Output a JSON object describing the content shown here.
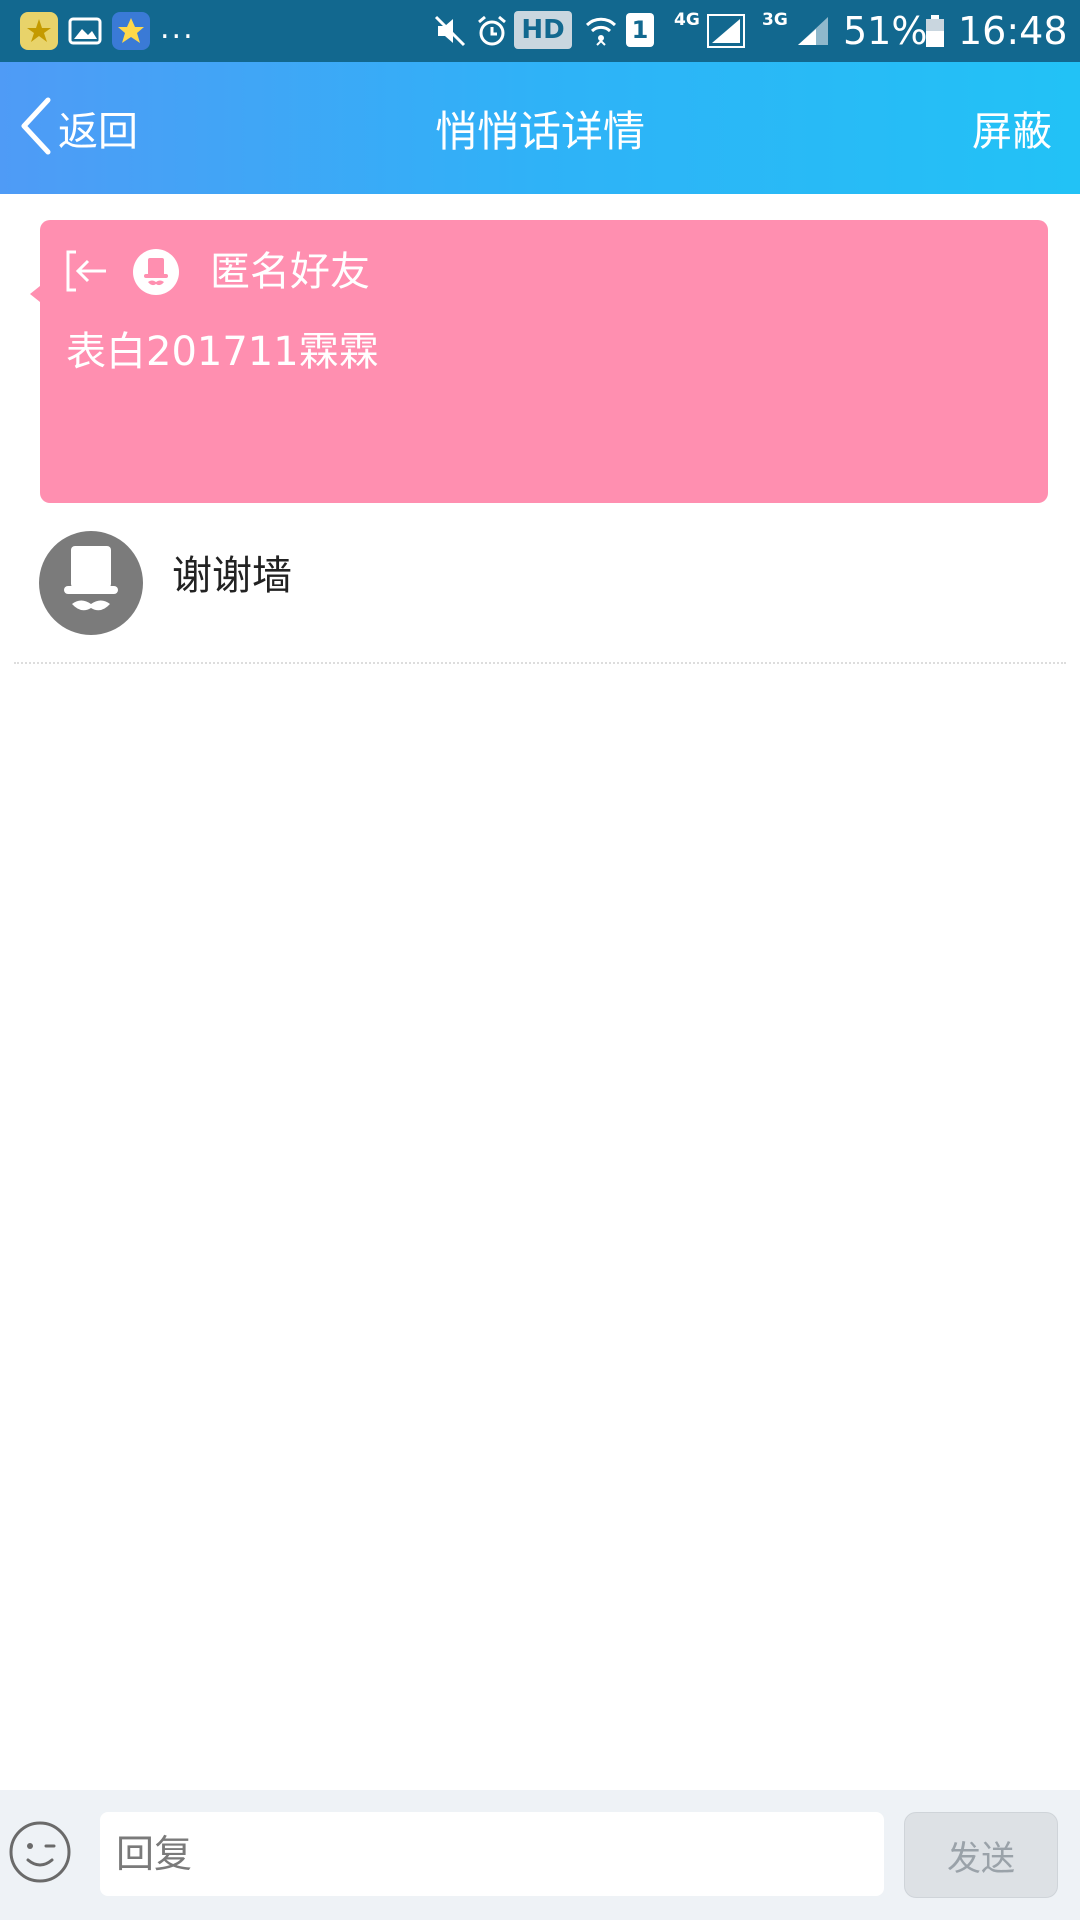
{
  "status_bar": {
    "more_indicator": "...",
    "hd_badge": "HD",
    "sim_slot": "1",
    "network_primary": "4G",
    "network_secondary": "3G",
    "battery_percent": "51%",
    "time": "16:48",
    "icons": [
      "qq-app-icon",
      "gallery-icon",
      "star-app-icon",
      "mute-icon",
      "alarm-icon",
      "wifi-icon",
      "signal-icon",
      "battery-icon"
    ]
  },
  "header": {
    "back_label": "返回",
    "title": "悄悄话详情",
    "block_label": "屏蔽"
  },
  "card": {
    "sender": "匿名好友",
    "message": "表白201711霖霖",
    "background_color": "#ff8fb0"
  },
  "wall": {
    "name": "谢谢墙"
  },
  "bottom_bar": {
    "reply_placeholder": "回复",
    "send_label": "发送"
  },
  "colors": {
    "status_bar": "#12688f",
    "header_start": "#4f9bf6",
    "header_end": "#22c2f6",
    "send_disabled_bg": "#dde1e5"
  }
}
